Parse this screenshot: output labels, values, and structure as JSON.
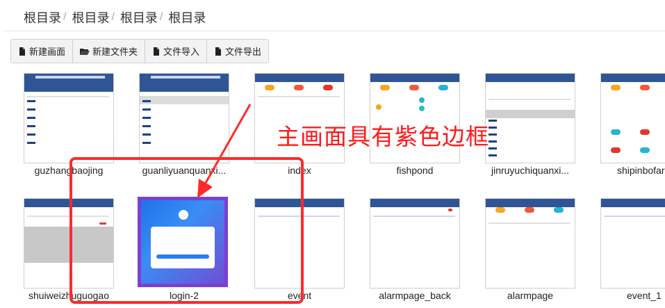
{
  "breadcrumb": [
    "根目录",
    "根目录",
    "根目录",
    "根目录"
  ],
  "toolbar": {
    "new_screen": "新建画面",
    "new_folder": "新建文件夹",
    "import_file": "文件导入",
    "export_file": "文件导出"
  },
  "screens_row1": [
    "guzhangbaojing",
    "guanliyuanquanxi...",
    "index",
    "fishpond",
    "jinruyuchiquanxi...",
    "shipinbofar"
  ],
  "screens_row2": [
    "shuiweizhuguogao",
    "login-2",
    "event",
    "alarmpage_back",
    "alarmpage",
    "event_1"
  ],
  "annotation": "主画面具有紫色边框",
  "colors": {
    "selected_border": "#7b3fd1",
    "annotation": "#ff1a1a"
  }
}
